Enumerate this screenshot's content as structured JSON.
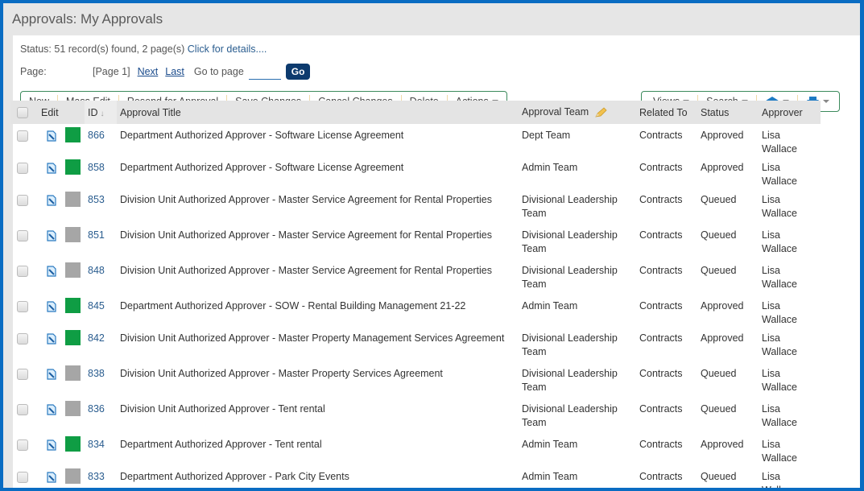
{
  "page": {
    "title": "Approvals: My Approvals"
  },
  "status": {
    "text": "Status: 51 record(s) found, 2 page(s)",
    "link": "Click for details...."
  },
  "pager": {
    "label": "Page:",
    "current": "[Page 1]",
    "next": "Next",
    "last": "Last",
    "goto_label": "Go to page",
    "goto_value": "",
    "go_button": "Go"
  },
  "toolbar_left": [
    "New",
    "Mass Edit",
    "Resend for Approval",
    "Save Changes",
    "Cancel Changes",
    "Delete",
    "Actions"
  ],
  "toolbar_right": {
    "views": "Views",
    "search": "Search",
    "email_icon": "envelope-open-icon",
    "print_icon": "printer-icon"
  },
  "colors": {
    "approved": "#0f9d44",
    "queued": "#a6a6a6",
    "frame": "#0a6cc2",
    "go": "#0d3b6e"
  },
  "table": {
    "headers": {
      "edit": "Edit",
      "id": "ID",
      "title": "Approval Title",
      "team": "Approval Team",
      "related": "Related To",
      "status": "Status",
      "approver": "Approver"
    },
    "rows": [
      {
        "id": "866",
        "title": "Department Authorized Approver - Software License Agreement",
        "team": "Dept Team",
        "related": "Contracts",
        "status": "Approved",
        "approver": "Lisa Wallace"
      },
      {
        "id": "858",
        "title": "Department Authorized Approver - Software License Agreement",
        "team": "Admin Team",
        "related": "Contracts",
        "status": "Approved",
        "approver": "Lisa Wallace"
      },
      {
        "id": "853",
        "title": "Division Unit Authorized Approver - Master Service Agreement for Rental Properties",
        "team": "Divisional Leadership Team",
        "related": "Contracts",
        "status": "Queued",
        "approver": "Lisa Wallace"
      },
      {
        "id": "851",
        "title": "Division Unit Authorized Approver - Master Service Agreement for Rental Properties",
        "team": "Divisional Leadership Team",
        "related": "Contracts",
        "status": "Queued",
        "approver": "Lisa Wallace"
      },
      {
        "id": "848",
        "title": "Division Unit Authorized Approver - Master Service Agreement for Rental Properties",
        "team": "Divisional Leadership Team",
        "related": "Contracts",
        "status": "Queued",
        "approver": "Lisa Wallace"
      },
      {
        "id": "845",
        "title": "Department Authorized Approver - SOW - Rental Building Management 21-22",
        "team": "Admin Team",
        "related": "Contracts",
        "status": "Approved",
        "approver": "Lisa Wallace"
      },
      {
        "id": "842",
        "title": "Division Unit Authorized Approver - Master Property Management Services Agreement",
        "team": "Divisional Leadership Team",
        "related": "Contracts",
        "status": "Approved",
        "approver": "Lisa Wallace"
      },
      {
        "id": "838",
        "title": "Division Unit Authorized Approver - Master Property Services Agreement",
        "team": "Divisional Leadership Team",
        "related": "Contracts",
        "status": "Queued",
        "approver": "Lisa Wallace"
      },
      {
        "id": "836",
        "title": "Division Unit Authorized Approver - Tent rental",
        "team": "Divisional Leadership Team",
        "related": "Contracts",
        "status": "Queued",
        "approver": "Lisa Wallace"
      },
      {
        "id": "834",
        "title": "Department Authorized Approver - Tent rental",
        "team": "Admin Team",
        "related": "Contracts",
        "status": "Approved",
        "approver": "Lisa Wallace"
      },
      {
        "id": "833",
        "title": "Department Authorized Approver - Park City Events",
        "team": "Admin Team",
        "related": "Contracts",
        "status": "Queued",
        "approver": "Lisa Wallace"
      }
    ]
  }
}
